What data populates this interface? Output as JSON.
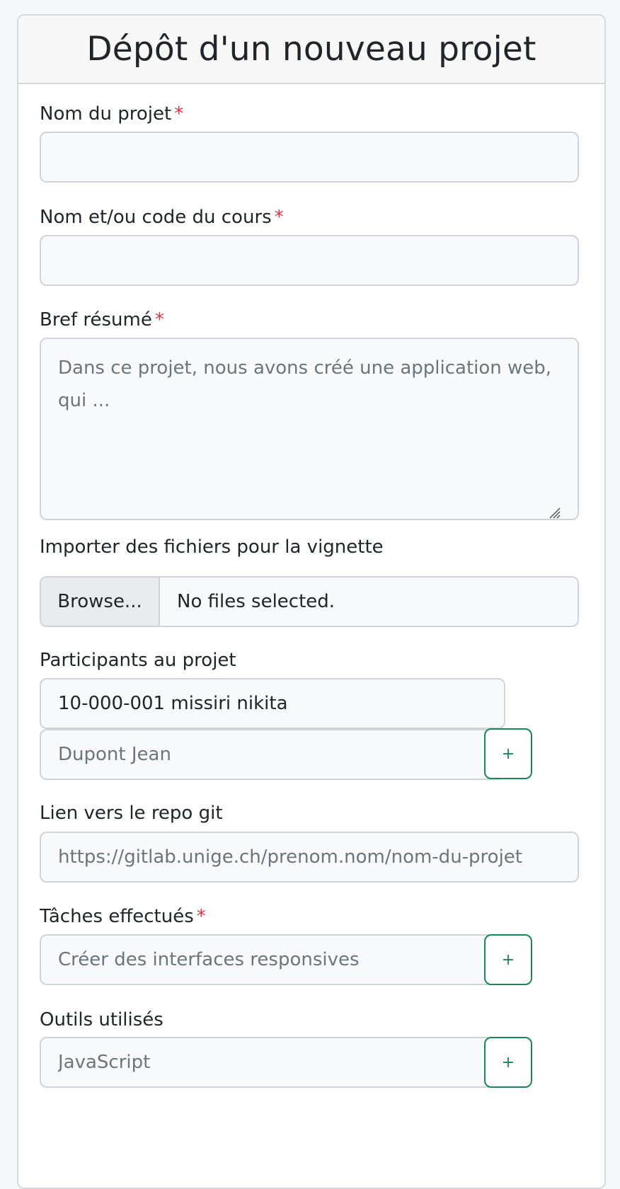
{
  "header": {
    "title": "Dépôt d'un nouveau projet"
  },
  "required_marker": "*",
  "fields": {
    "project_name": {
      "label": "Nom du projet",
      "value": ""
    },
    "course": {
      "label": "Nom et/ou code du cours",
      "value": ""
    },
    "summary": {
      "label": "Bref résumé",
      "placeholder": "Dans ce projet, nous avons créé une application web, qui ..."
    },
    "thumbnail": {
      "label": "Importer des fichiers pour la vignette",
      "browse_label": "Browse...",
      "status": "No files selected."
    },
    "participants": {
      "label": "Participants au projet",
      "value": "10-000-001 missiri nikita",
      "placeholder": "Dupont Jean",
      "add_label": "+"
    },
    "git": {
      "label": "Lien vers le repo git",
      "placeholder": "https://gitlab.unige.ch/prenom.nom/nom-du-projet"
    },
    "tasks": {
      "label": "Tâches effectués",
      "placeholder": "Créer des interfaces responsives",
      "add_label": "+"
    },
    "tools": {
      "label": "Outils utilisés",
      "placeholder": "JavaScript",
      "add_label": "+"
    }
  },
  "colors": {
    "required": "#dc3545",
    "add_button": "#198754",
    "border": "#ced4da",
    "input_bg": "#f8f9fa"
  }
}
